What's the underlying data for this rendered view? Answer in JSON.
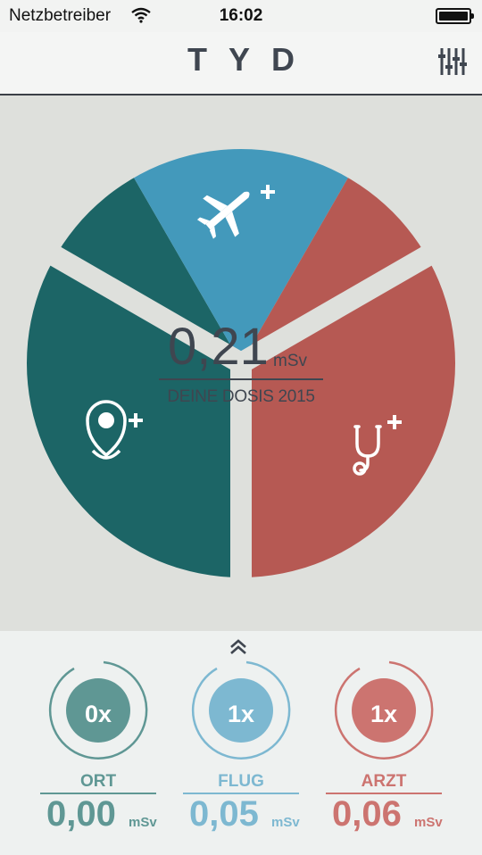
{
  "status_bar": {
    "carrier": "Netzbetreiber",
    "time": "16:02"
  },
  "app": {
    "logo": "TYD"
  },
  "dose": {
    "value": "0,21",
    "unit": "mSv",
    "label": "DEINE DOSIS 2015"
  },
  "colors": {
    "flight": "#4399bb",
    "location": "#1c6566",
    "doctor": "#b65953",
    "stage_bg": "#dee0dc"
  },
  "segments": [
    {
      "name": "location",
      "icon": "map-pin-plus-icon"
    },
    {
      "name": "flight",
      "icon": "airplane-plus-icon"
    },
    {
      "name": "doctor",
      "icon": "stethoscope-plus-icon"
    }
  ],
  "stats": [
    {
      "count": "0x",
      "label": "ORT",
      "value": "0,00",
      "unit": "mSv",
      "color": "#5f9794"
    },
    {
      "count": "1x",
      "label": "FLUG",
      "value": "0,05",
      "unit": "mSv",
      "color": "#7db8d1"
    },
    {
      "count": "1x",
      "label": "ARZT",
      "value": "0,06",
      "unit": "mSv",
      "color": "#cc7470"
    }
  ]
}
